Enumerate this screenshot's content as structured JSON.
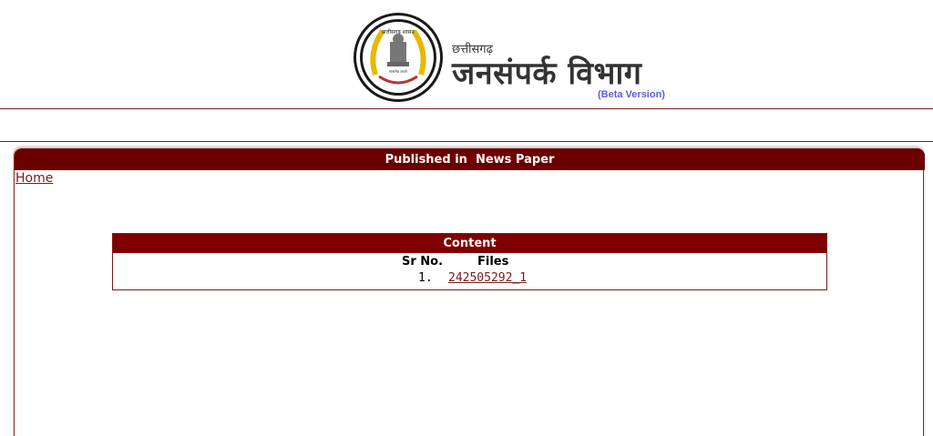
{
  "header": {
    "emblem_top_text": "छत्तीसगढ़ शासन",
    "emblem_bottom_text": "सत्यमेव जयते",
    "small_title": "छत्तीसगढ़",
    "big_title": "जनसंपर्क विभाग",
    "beta_label": "(Beta Version)",
    "logo_icon": "state-emblem-seal"
  },
  "panel": {
    "title": "Published in  News Paper",
    "home_link": "Home"
  },
  "content_table": {
    "title": "Content",
    "columns": [
      "Sr No.",
      "Files"
    ],
    "rows": [
      {
        "sr": "1.",
        "file": "242505292_1"
      }
    ]
  },
  "colors": {
    "header_bar": "#6b0000",
    "table_header": "#800000",
    "link": "#7a1a1a",
    "beta_text": "#5a5fd6"
  }
}
